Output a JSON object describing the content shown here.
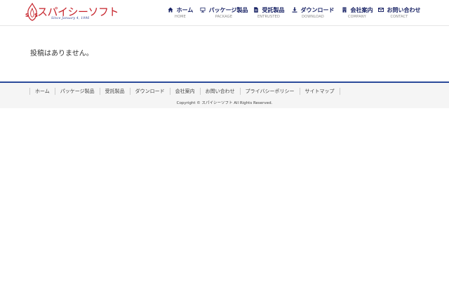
{
  "logo": {
    "name": "スパイシーソフト",
    "tagline": "Since January 4, 1996"
  },
  "nav": [
    {
      "label": "ホーム",
      "sub": "HOME",
      "icon": "home-icon"
    },
    {
      "label": "パッケージ製品",
      "sub": "PACKAGE",
      "icon": "monitor-icon"
    },
    {
      "label": "受託製品",
      "sub": "ENTRUSTED",
      "icon": "document-icon"
    },
    {
      "label": "ダウンロード",
      "sub": "DOWNLOAD",
      "icon": "download-icon"
    },
    {
      "label": "会社案内",
      "sub": "COMPANY",
      "icon": "building-icon"
    },
    {
      "label": "お問い合わせ",
      "sub": "CONTACT",
      "icon": "envelope-icon"
    }
  ],
  "main": {
    "message": "投稿はありません。"
  },
  "footer": {
    "links": [
      "ホーム",
      "パッケージ製品",
      "受託製品",
      "ダウンロード",
      "会社案内",
      "お問い合わせ",
      "プライバシーポリシー",
      "サイトマップ"
    ],
    "copyright": "Copyright © スパイシーソフト All Rights Reserved."
  },
  "colors": {
    "nav_text": "#1a2466",
    "footer_border": "#2b4a9a",
    "logo_red": "#c6232b"
  }
}
